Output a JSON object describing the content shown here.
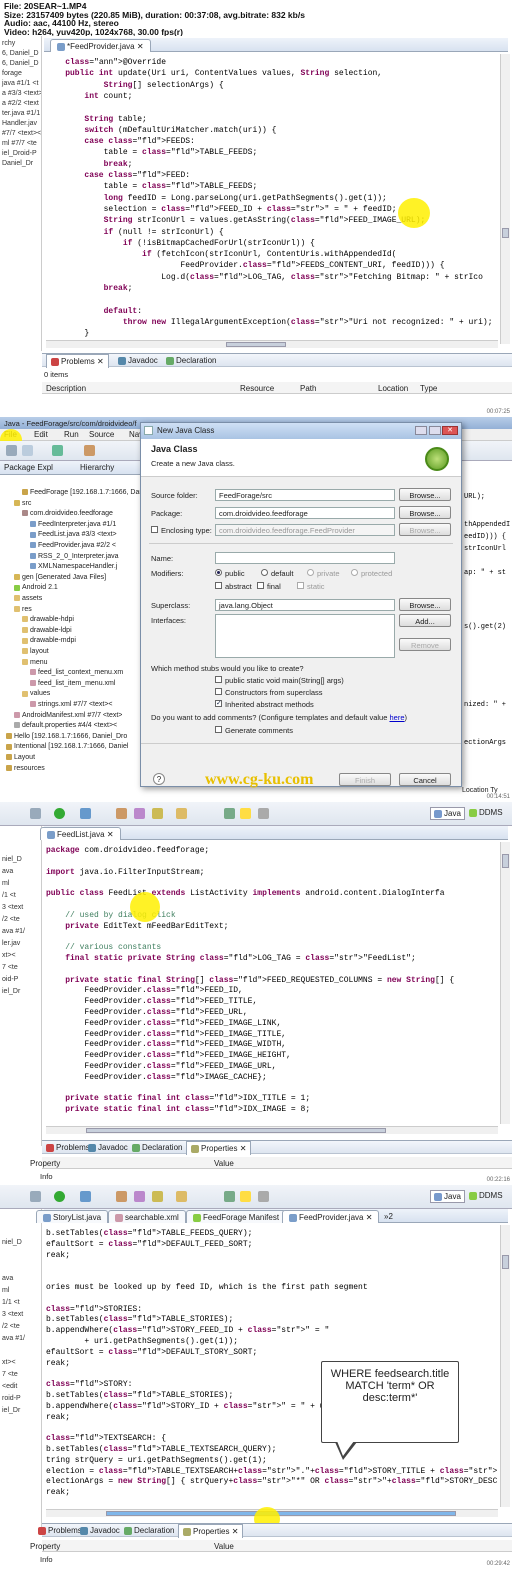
{
  "header": {
    "line1": "File: 20SEAR~1.MP4",
    "line2": "Size: 23157409 bytes (220.85 MiB), duration: 00:37:08, avg.bitrate: 832 kb/s",
    "line3": "Audio: aac, 44100 Hz, stereo",
    "line4": "Video: h264, yuv420p, 1024x768, 30.00 fps(r)"
  },
  "frame1": {
    "timestamp": "00:07:25",
    "gutter": [
      "rchy",
      "6, Daniel_D",
      "6, Daniel_D",
      "forage",
      "java #1/1 <t",
      "a #3/3 <text>",
      "a #2/2 <text",
      "ter.java #1/1",
      "Handler.jav",
      "#7/7 <text><",
      "ml #7/7 <te",
      "iel_Droid-P",
      "Daniel_Dr"
    ],
    "tab": "*FeedProvider.java",
    "code": [
      "    @Override",
      "    public int update(Uri uri, ContentValues values, String selection,",
      "            String[] selectionArgs) {",
      "        int count;",
      "",
      "        String table;",
      "        switch (mDefaultUriMatcher.match(uri)) {",
      "        case FEEDS:",
      "            table = TABLE_FEEDS;",
      "            break;",
      "        case FEED:",
      "            table = TABLE_FEEDS;",
      "            long feedID = Long.parseLong(uri.getPathSegments().get(1));",
      "            selection = FEED_ID + \" = \" + feedID;",
      "            String strIconUrl = values.getAsString(FEED_IMAGE_URL);",
      "            if (null != strIconUrl) {",
      "                if (!isBitmapCachedForUrl(strIconUrl)) {",
      "                    if (fetchIcon(strIconUrl, ContentUris.withAppendedId(",
      "                            FeedProvider.FEEDS_CONTENT_URI, feedID))) {",
      "                        Log.d(LOG_TAG, \"Fetching Bitmap: \" + strIco",
      "            break;",
      "",
      "            default:",
      "                throw new IllegalArgumentException(\"Uri not recognized: \" + uri);",
      "        }"
    ],
    "panel_tabs": [
      "Problems",
      "Javadoc",
      "Declaration"
    ],
    "items": "0 items",
    "columns": [
      "Description",
      "Resource",
      "Path",
      "Location",
      "Type"
    ]
  },
  "frame2": {
    "timestamp": "00:14:51",
    "window_title": "Java - FeedForage/src/com/droidvideo/f",
    "menu": [
      "File",
      "Edit",
      "Run",
      "Source",
      "Navigate",
      "Sear"
    ],
    "side_tabs": [
      "Package Expl",
      "Hierarchy"
    ],
    "tree": [
      "FeedForage [192.168.1.7:1666, Danie",
      "src",
      "com.droidvideo.feedforage",
      "FeedInterpreter.java #1/1",
      "FeedList.java #3/3 <text>",
      "FeedProvider.java #2/2 <",
      "RSS_2_0_Interpreter.java",
      "XMLNamespaceHandler.j",
      "gen [Generated Java Files]",
      "Android 2.1",
      "assets",
      "res",
      "drawable-hdpi",
      "drawable-ldpi",
      "drawable-mdpi",
      "layout",
      "menu",
      "feed_list_context_menu.xm",
      "feed_list_item_menu.xml",
      "values",
      "strings.xml #7/7 <text><",
      "AndroidManifest.xml #7/7 <text>",
      "default.properties #4/4 <text><",
      "Hello [192.168.1.7:1666, Daniel_Dro",
      "Intentional [192.168.1.7:1666, Daniel",
      "Layout",
      "resources"
    ],
    "right_code": [
      "URL);",
      "thAppendedI",
      "eedID))) {",
      "strIconUrl",
      "ap: \" + st",
      "s().get(2)",
      "nized: \" +",
      "ectionArgs"
    ],
    "right_footer": [
      "Location",
      "Ty"
    ],
    "dialog": {
      "title": "New Java Class",
      "heading": "Java Class",
      "subheading": "Create a new Java class.",
      "source_folder_label": "Source folder:",
      "source_folder_value": "FeedForage/src",
      "package_label": "Package:",
      "package_value": "com.droidvideo.feedforage",
      "enclosing_label": "Enclosing type:",
      "enclosing_value": "com.droidvideo.feedforage.FeedProvider",
      "browse": "Browse...",
      "name_label": "Name:",
      "modifiers_label": "Modifiers:",
      "mod_public": "public",
      "mod_default": "default",
      "mod_private": "private",
      "mod_protected": "protected",
      "mod_abstract": "abstract",
      "mod_final": "final",
      "mod_static": "static",
      "superclass_label": "Superclass:",
      "superclass_value": "java.lang.Object",
      "interfaces_label": "Interfaces:",
      "add": "Add...",
      "remove": "Remove",
      "stubs_question": "Which method stubs would you like to create?",
      "stub_main": "public static void main(String[] args)",
      "stub_ctors": "Constructors from superclass",
      "stub_inherited": "Inherited abstract methods",
      "comments_question": "Do you want to add comments? (Configure templates and default value ",
      "comments_link": "here",
      "comments_end": ")",
      "generate_comments": "Generate comments",
      "watermark": "www.cg-ku.com",
      "finish": "Finish",
      "cancel": "Cancel",
      "help": "?"
    }
  },
  "frame3": {
    "timestamp": "00:22:16",
    "perspectives": [
      "Java",
      "DDMS"
    ],
    "tab": "FeedList.java",
    "gutter": [
      "niel_D",
      "ava",
      "ml",
      "/1 <t",
      "3 <text",
      "/2 <te",
      "ava #1/",
      "ler.jav",
      "xt><",
      "7 <te",
      "oid-P",
      "iel_Dr"
    ],
    "code": [
      "package com.droidvideo.feedforage;",
      "",
      "import java.io.FilterInputStream;",
      "",
      "public class FeedList extends ListActivity implements android.content.DialogInterfa",
      "",
      "    // used by dialog click",
      "    private EditText mFeedBarEditText;",
      "",
      "    // various constants",
      "    final static private String LOG_TAG = \"FeedList\";",
      "",
      "    private static final String[] FEED_REQUESTED_COLUMNS = new String[] {",
      "        FeedProvider.FEED_ID,",
      "        FeedProvider.FEED_TITLE,",
      "        FeedProvider.FEED_URL,",
      "        FeedProvider.FEED_IMAGE_LINK,",
      "        FeedProvider.FEED_IMAGE_TITLE,",
      "        FeedProvider.FEED_IMAGE_WIDTH,",
      "        FeedProvider.FEED_IMAGE_HEIGHT,",
      "        FeedProvider.FEED_IMAGE_URL,",
      "        FeedProvider.IMAGE_CACHE};",
      "",
      "    private static final int IDX_TITLE = 1;",
      "    private static final int IDX_IMAGE = 8;"
    ],
    "panel_tabs": [
      "Problems",
      "Javadoc",
      "Declaration",
      "Properties"
    ],
    "columns": [
      "Property",
      "Value"
    ],
    "row": "Info"
  },
  "frame4": {
    "timestamp": "00:29:42",
    "perspectives": [
      "Java",
      "DDMS"
    ],
    "tabs": [
      "StoryList.java",
      "searchable.xml",
      "FeedForage Manifest",
      "FeedProvider.java",
      "»2"
    ],
    "gutter": [
      "niel_D",
      "",
      "",
      "ava",
      "ml",
      "1/1 <t",
      "3 <text",
      "/2 <te",
      "ava #1/",
      "",
      "xt><",
      "7 <te",
      "<edit",
      "roid-P",
      "iel_Dr"
    ],
    "code": [
      "b.setTables(TABLE_FEEDS_QUERY);",
      "efaultSort = DEFAULT_FEED_SORT;",
      "reak;",
      "",
      "",
      "ories must be looked up by feed ID, which is the first path segment",
      "",
      "STORIES:",
      "b.setTables(TABLE_STORIES);",
      "b.appendWhere(STORY_FEED_ID + \" = \"",
      "        + uri.getPathSegments().get(1));",
      "efaultSort = DEFAULT_STORY_SORT;",
      "reak;",
      "",
      "STORY:",
      "b.setTables(TABLE_STORIES);",
      "b.appendWhere(STORY_ID + \" = \" + uri.getPathSegments().",
      "reak;",
      "",
      "TEXTSEARCH: {",
      "b.setTables(TABLE_TEXTSEARCH_QUERY);",
      "tring strQuery = uri.getPathSegments().get(1);",
      "election = TABLE_TEXTSEARCH+\".\"+STORY_TITLE + \" MATCH ?\";",
      "electionArgs = new String[] { strQuery+\"*\" OR \"+STORY_DESCRIPTION+\":\"+strQuery+\"*\" };",
      "reak;"
    ],
    "callout": "WHERE feedsearch.title MATCH 'term* OR desc:term*'",
    "panel_tabs": [
      "Problems",
      "Javadoc",
      "Declaration",
      "Properties"
    ],
    "columns": [
      "Property",
      "Value"
    ],
    "row": "Info"
  }
}
